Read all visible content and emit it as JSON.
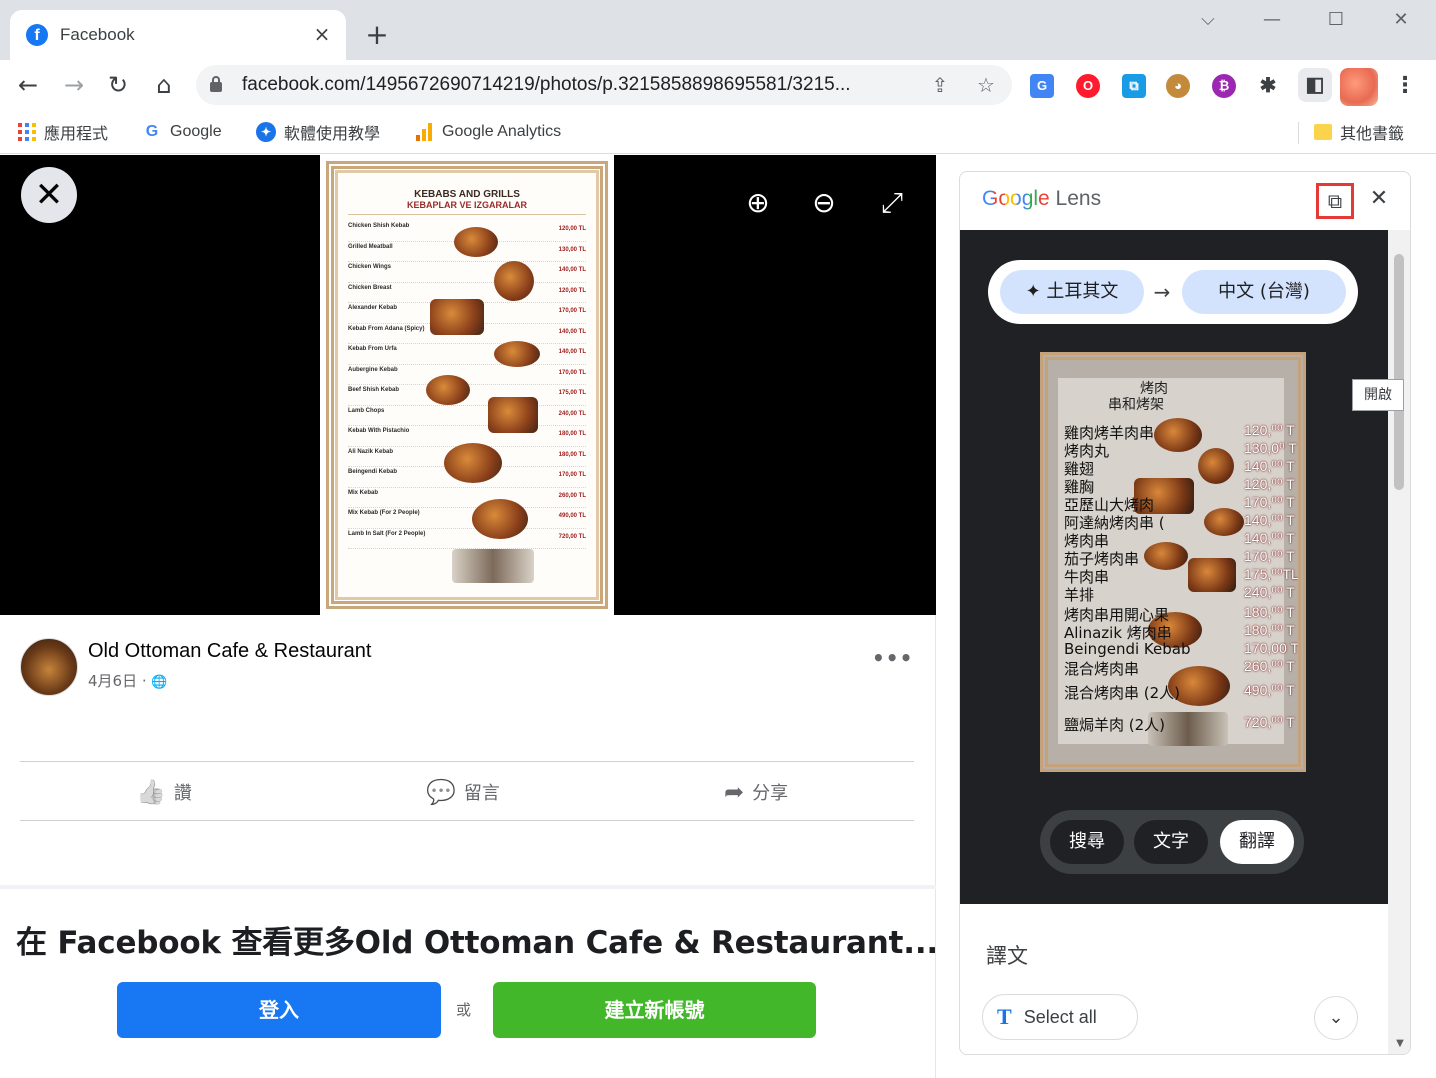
{
  "browser": {
    "tab": {
      "title": "Facebook",
      "favicon": "f"
    },
    "new_tab_icon": "+",
    "window_controls": [
      "⌵",
      "—",
      "☐",
      "✕"
    ],
    "nav": {
      "back": "←",
      "forward": "→",
      "reload": "↻",
      "home": "⌂"
    },
    "url": "facebook.com/1495672690714219/photos/p.3215858898695581/3215...",
    "omni_icons": {
      "share": "⇪",
      "star": "☆"
    },
    "extensions": [
      "translate-ext",
      "opera-ext",
      "copy-ext",
      "squirrel-ext",
      "crypto-ext",
      "puzzle-ext",
      "sidepanel-ext"
    ],
    "menu": "⋮"
  },
  "bookmarks": {
    "items": [
      {
        "label": "應用程式"
      },
      {
        "label": "Google"
      },
      {
        "label": "軟體使用教學"
      },
      {
        "label": "Google Analytics"
      }
    ],
    "other": "其他書籤"
  },
  "photo": {
    "close": "✕",
    "zoom_in": "⊕",
    "zoom_out": "⊖",
    "fullscreen": "⤢",
    "menu_title": "KEBABS AND GRILLS",
    "menu_subtitle": "KEBAPLAR VE IZGARALAR",
    "menu_items": [
      {
        "name": "Chicken Shish Kebab",
        "price": "120,00 TL"
      },
      {
        "name": "Grilled Meatball",
        "price": "130,00 TL"
      },
      {
        "name": "Chicken Wings",
        "price": "140,00 TL"
      },
      {
        "name": "Chicken Breast",
        "price": "120,00 TL"
      },
      {
        "name": "Alexander Kebab",
        "price": "170,00 TL"
      },
      {
        "name": "Kebab From Adana (Spicy)",
        "price": "140,00 TL"
      },
      {
        "name": "Kebab From Urfa",
        "price": "140,00 TL"
      },
      {
        "name": "Aubergine Kebab",
        "price": "170,00 TL"
      },
      {
        "name": "Beef Shish Kebab",
        "price": "175,00 TL"
      },
      {
        "name": "Lamb Chops",
        "price": "240,00 TL"
      },
      {
        "name": "Kebab With Pistachio",
        "price": "180,00 TL"
      },
      {
        "name": "Ali Nazik Kebab",
        "price": "180,00 TL"
      },
      {
        "name": "Beingendi Kebab",
        "price": "170,00 TL"
      },
      {
        "name": "Mix Kebab",
        "price": "260,00 TL"
      },
      {
        "name": "Mix Kebab (For 2 People)",
        "price": "490,00 TL"
      },
      {
        "name": "Lamb In Salt (For 2 People)",
        "price": "720,00 TL"
      }
    ]
  },
  "post": {
    "page_name": "Old Ottoman Cafe & Restaurant",
    "date": "4月6日 · ",
    "privacy_icon": "🌐",
    "more": "•••",
    "actions": [
      {
        "icon": "👍",
        "label": "讚"
      },
      {
        "icon": "💬",
        "label": "留言"
      },
      {
        "icon": "➦",
        "label": "分享"
      }
    ]
  },
  "cta": {
    "title": "在 Facebook 查看更多Old Ottoman Cafe & Restaurant...",
    "login": "登入",
    "or": "或",
    "create": "建立新帳號"
  },
  "lens": {
    "logo": "Google",
    "logo_suffix": " Lens",
    "open_icon": "⧉",
    "close_icon": "✕",
    "tooltip": "開啟",
    "source_lang": "✦ 土耳其文",
    "arrow": "→",
    "target_lang": "中文 (台灣)",
    "translated_head": "烤肉",
    "translated_sub": "串和烤架",
    "translated_rows": [
      {
        "text": "雞肉烤羊肉串",
        "price": "120,⁰⁰ T"
      },
      {
        "text": "烤肉丸",
        "price": "130,0⁰ T"
      },
      {
        "text": "雞翅",
        "price": "140,⁰⁰ T"
      },
      {
        "text": "雞胸",
        "price": "120,⁰⁰ T"
      },
      {
        "text": "亞歷山大烤肉",
        "price": "170,⁰⁰ T"
      },
      {
        "text": "阿達納烤肉串 (",
        "price": "140,⁰⁰ T"
      },
      {
        "text": "烤肉串",
        "price": "140,⁰⁰ T"
      },
      {
        "text": "茄子烤肉串",
        "price": "170,⁰⁰ T"
      },
      {
        "text": "牛肉串",
        "price": "175,⁰⁰TL"
      },
      {
        "text": "羊排",
        "price": "240,⁰⁰ T"
      },
      {
        "text": "烤肉串用開心果",
        "price": "180,⁰⁰ T"
      },
      {
        "text": "Alinazik 烤肉串",
        "price": "180,⁰⁰ T"
      },
      {
        "text": "Beingendi Kebab",
        "price": "170,00 T"
      },
      {
        "text": "混合烤肉串",
        "price": "260,⁰⁰ T"
      },
      {
        "text": "混合烤肉串 (2人)",
        "price": "490,⁰⁰ T"
      },
      {
        "text": "鹽焗羊肉 (2人)",
        "price": "720,⁰⁰ T"
      }
    ],
    "modes": [
      "搜尋",
      "文字",
      "翻譯"
    ],
    "active_mode": "翻譯",
    "translation_label": "譯文",
    "select_all": "Select all",
    "select_all_icon": "T",
    "expand": "⌄"
  },
  "colors": {
    "facebook_blue": "#1877f2",
    "facebook_green": "#42b72a",
    "lens_dark": "#202124",
    "lang_chip": "#d3e3fd",
    "highlight_red": "#e53935"
  }
}
